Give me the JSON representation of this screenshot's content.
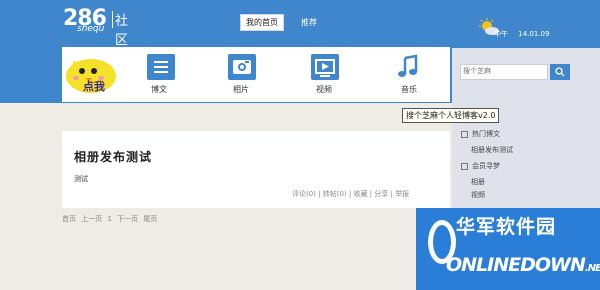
{
  "logo": {
    "digits": "286",
    "sub": "shequ",
    "cn": "社区"
  },
  "topnav": {
    "items": [
      {
        "label": "我的首页",
        "active": true
      },
      {
        "label": "推荐",
        "active": false
      }
    ]
  },
  "weather": {
    "icon": "sun-cloud-icon",
    "period": "中午",
    "date": "14.01.09"
  },
  "mascot": {
    "label": "点我"
  },
  "mainnav": {
    "items": [
      {
        "label": "博文",
        "icon": "article-icon"
      },
      {
        "label": "相片",
        "icon": "camera-icon"
      },
      {
        "label": "视频",
        "icon": "video-icon"
      },
      {
        "label": "音乐",
        "icon": "music-icon"
      }
    ]
  },
  "search": {
    "placeholder": "搜个芝麻",
    "button_icon": "search-icon"
  },
  "tooltip": "搜个芝麻个人轻博客v2.0",
  "sidebar": {
    "items": [
      {
        "type": "heading",
        "label": "热门博文"
      },
      {
        "type": "link",
        "label": "相册发布测试"
      },
      {
        "type": "heading",
        "label": "会员寻梦"
      },
      {
        "type": "link",
        "label": "相册"
      },
      {
        "type": "link",
        "label": "视频"
      }
    ]
  },
  "post": {
    "title": "相册发布测试",
    "body": "测试",
    "meta": "评论(0) | 转帖(0) | 收藏 | 分享 | 举报"
  },
  "pager": {
    "items": [
      "首页",
      "上一页",
      "1",
      "下一页",
      "尾页"
    ]
  },
  "watermark": {
    "cn": "华军软件园",
    "en": "ONLINEDOWN",
    "suffix": ".NET"
  },
  "colors": {
    "primary": "#3f86cc",
    "background": "#eeece4",
    "sidebar": "#dfe2ea",
    "watermark": "#2a7ed8"
  }
}
